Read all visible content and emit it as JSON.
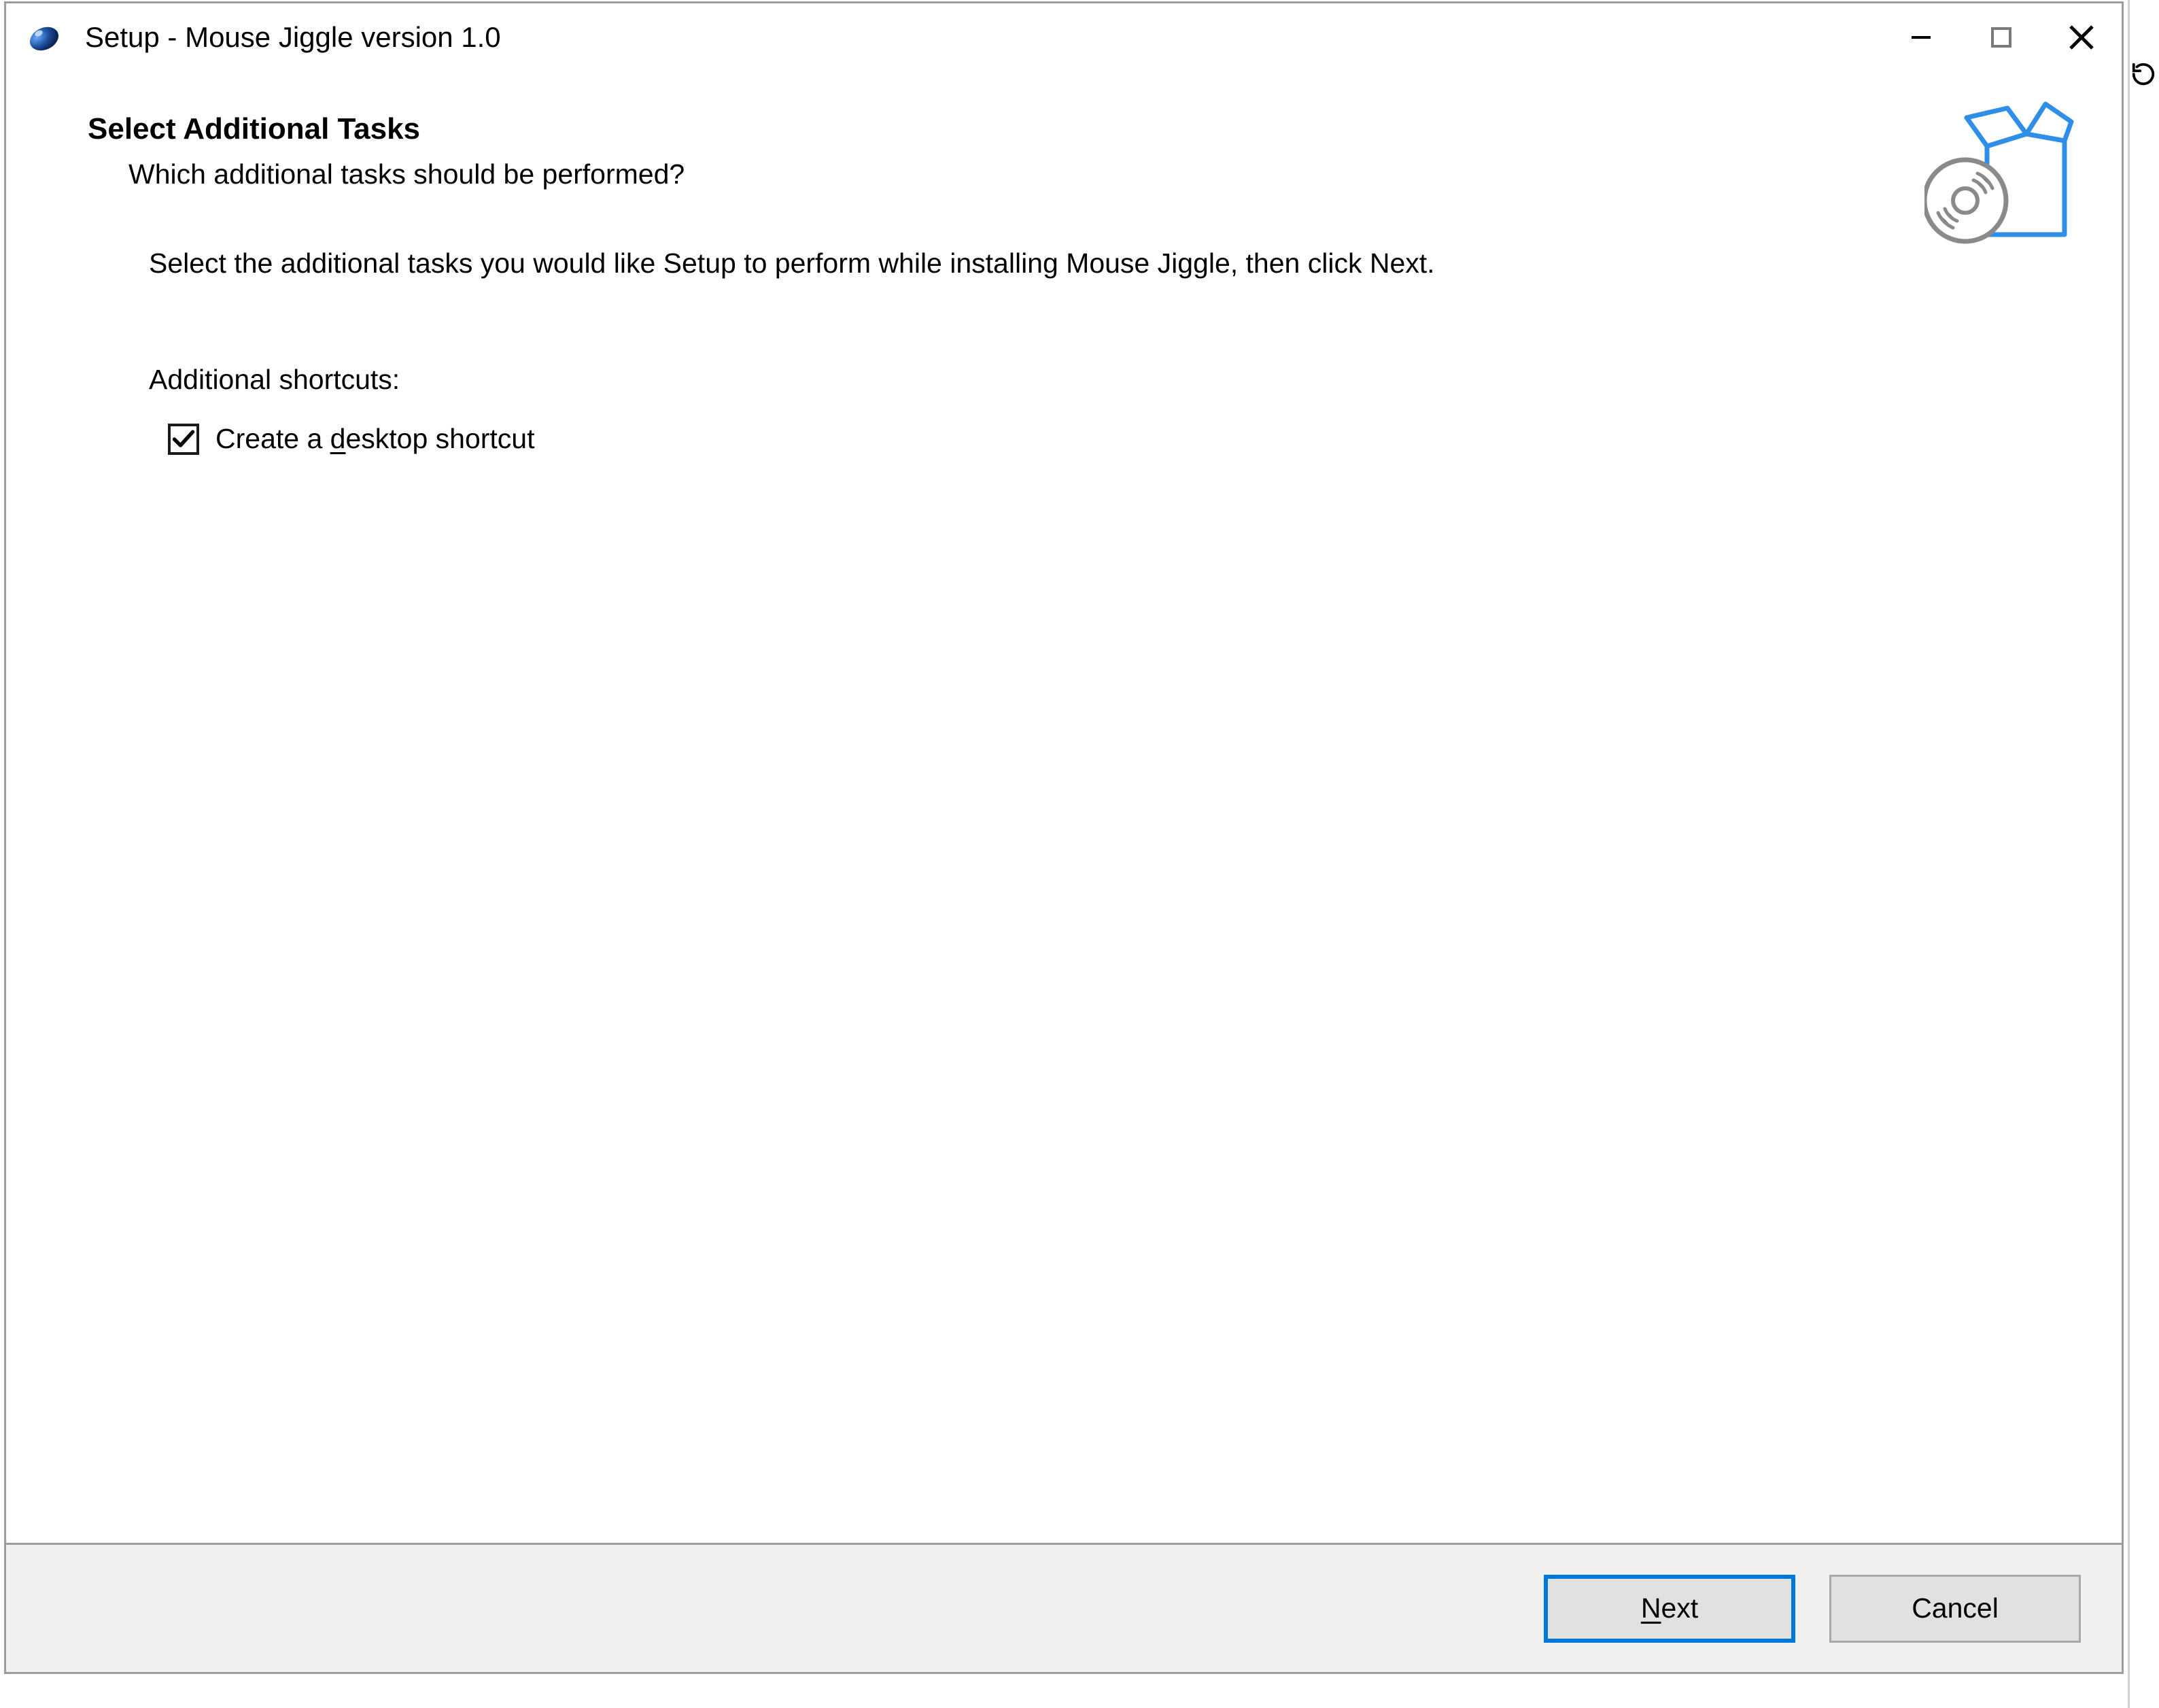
{
  "titlebar": {
    "title": "Setup - Mouse Jiggle version 1.0"
  },
  "header": {
    "page_title": "Select Additional Tasks",
    "page_subtitle": "Which additional tasks should be performed?"
  },
  "body": {
    "instruction": "Select the additional tasks you would like Setup to perform while installing Mouse Jiggle, then click Next.",
    "section_label": "Additional shortcuts:",
    "checkbox": {
      "label_before": "Create a ",
      "label_uk": "d",
      "label_after": "esktop shortcut",
      "checked": true
    }
  },
  "footer": {
    "next": {
      "pre": "",
      "uk": "N",
      "post": "ext"
    },
    "cancel": {
      "label": "Cancel"
    }
  }
}
